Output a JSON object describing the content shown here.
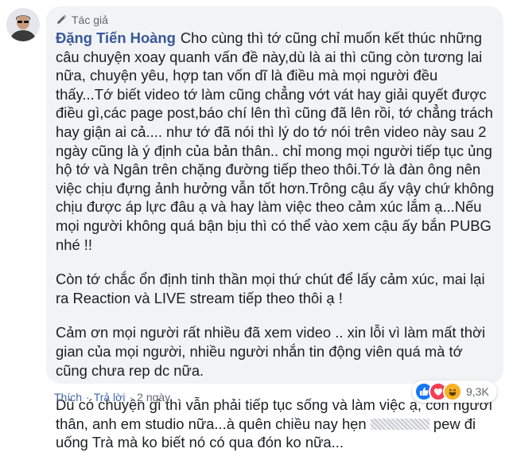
{
  "comment": {
    "author_badge": "Tác giả",
    "author_name": "Đặng Tiến Hoàng",
    "paragraphs": [
      "Cho cùng thì tớ cũng chỉ muốn kết thúc những câu chuyện xoay quanh vấn đề này,dù là ai thì cũng còn tương lai nữa, chuyện yêu, hợp tan vốn dĩ là điều mà mọi người đều thấy...Tớ biết video tớ làm cũng chẳng vớt vát hay giải quyết được điều gì,các page post,báo chí lên thì cũng đã lên rồi, tớ chẳng trách hay giận ai cả.... như tớ đã nói thì lý do tớ nói trên video này sau 2 ngày cũng là ý định của bản thân.. chỉ mong mọi người tiếp tục ủng hộ tớ và Ngân trên chặng đường tiếp theo thôi.Tớ là đàn ông nên việc chịu đựng ảnh hưởng vẫn tốt hơn.Trông cậu ấy vậy chứ không chịu được áp lực đâu ạ và hay làm việc theo cảm xúc lắm ạ...Nếu mọi người không quá bận bịu thì có thể vào xem cậu ấy bắn PUBG nhé !!",
      "Còn tớ chắc ổn định tinh thần mọi thứ chút để lấy cảm xúc, mai lại ra Reaction và LIVE stream tiếp theo thôi ạ !",
      "Cảm ơn mọi người rất nhiều đã xem video .. xin lỗi vì làm mất thời gian của mọi người, nhiều người nhắn tin động viên quá mà tớ cũng chưa rep dc nữa."
    ],
    "last_paragraph_before": "Dù có chuyện gì thì vẫn phải tiếp tục sống và làm việc ạ, còn người thân, anh em studio nữa...à quên chiều nay hẹn",
    "last_paragraph_after": "pew đi uống Trà mà ko biết nó có qua đón ko nữa..."
  },
  "actions": {
    "like": "Thích",
    "separator": "·",
    "reply": "Trả lời",
    "time": "2 ngày"
  },
  "reactions": {
    "icons": [
      "like-reaction",
      "love-reaction",
      "haha-reaction"
    ],
    "count": "9,3K",
    "colors": {
      "like": "#1877f2",
      "love": "#f33e58",
      "haha": "#f7b125"
    }
  },
  "theme": {
    "bubble": "#f2f3f5",
    "name": "#385898",
    "link": "#4267b2",
    "meta": "#606770"
  }
}
